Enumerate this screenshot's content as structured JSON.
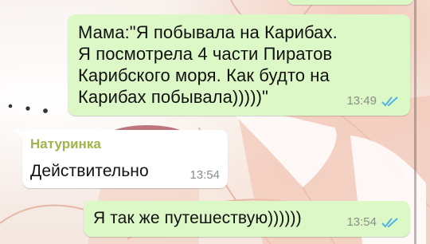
{
  "colors": {
    "outgoing_bubble": "#dcf8c6",
    "incoming_bubble": "#ffffff",
    "sender_name": "#a2b34a",
    "read_check": "#4fb3e8",
    "timestamp": "#8a8f86"
  },
  "messages": [
    {
      "direction": "outgoing",
      "text": "Мама:\"Я побывала на Карибах.\nЯ посмотрела 4 части Пиратов\nКарибского моря. Как будто на\nКарибах побывала)))))\"",
      "time": "13:49",
      "status_icon": "double-check-read-icon"
    },
    {
      "direction": "incoming",
      "sender": "Натуринка",
      "text": "Действительно",
      "time": "13:54"
    },
    {
      "direction": "outgoing",
      "text": "Я так же путешествую))))))",
      "time": "13:54",
      "status_icon": "double-check-read-icon"
    }
  ]
}
